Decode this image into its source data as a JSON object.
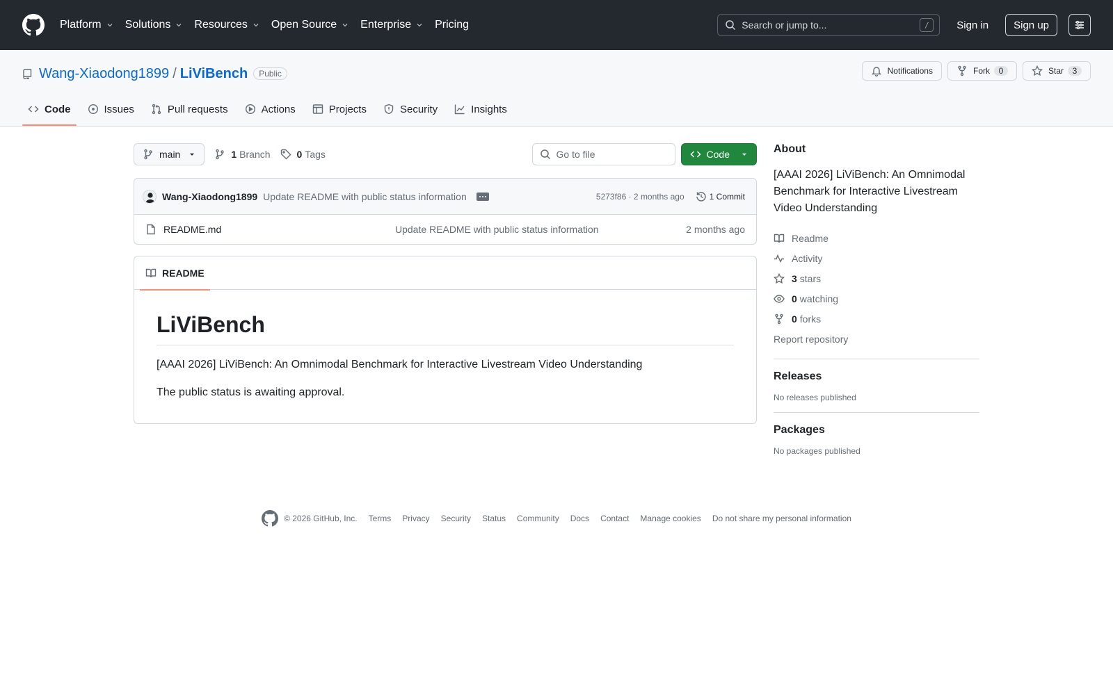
{
  "header": {
    "nav": [
      "Platform",
      "Solutions",
      "Resources",
      "Open Source",
      "Enterprise",
      "Pricing"
    ],
    "search_placeholder": "Search or jump to...",
    "search_key": "/",
    "sign_in": "Sign in",
    "sign_up": "Sign up"
  },
  "repo": {
    "owner": "Wang-Xiaodong1899",
    "separator": "/",
    "name": "LiViBench",
    "visibility": "Public",
    "notifications_label": "Notifications",
    "fork_label": "Fork",
    "fork_count": "0",
    "star_label": "Star",
    "star_count": "3"
  },
  "tabs": [
    "Code",
    "Issues",
    "Pull requests",
    "Actions",
    "Projects",
    "Security",
    "Insights"
  ],
  "file_nav": {
    "branch": "main",
    "branch_count": "1",
    "branch_label": "Branch",
    "tag_count": "0",
    "tag_label": "Tags",
    "goto_placeholder": "Go to file",
    "code_button": "Code"
  },
  "commit": {
    "author": "Wang-Xiaodong1899",
    "message": "Update README with public status information",
    "hash_time": "5273f86 · 2 months ago",
    "commit_count": "1 Commit"
  },
  "files": [
    {
      "name": "README.md",
      "message": "Update README with public status information",
      "age": "2 months ago"
    }
  ],
  "readme": {
    "tab_label": "README",
    "title": "LiViBench",
    "paragraphs": [
      "[AAAI 2026] LiViBench: An Omnimodal Benchmark for Interactive Livestream Video Understanding",
      "The public status is awaiting approval."
    ]
  },
  "about": {
    "title": "About",
    "description": "[AAAI 2026] LiViBench: An Omnimodal Benchmark for Interactive Livestream Video Understanding",
    "readme": "Readme",
    "activity": "Activity",
    "stars_count": "3",
    "stars_label": "stars",
    "watching_count": "0",
    "watching_label": "watching",
    "forks_count": "0",
    "forks_label": "forks",
    "report": "Report repository"
  },
  "releases": {
    "title": "Releases",
    "empty": "No releases published"
  },
  "packages": {
    "title": "Packages",
    "empty": "No packages published"
  },
  "footer": {
    "copyright": "© 2026 GitHub, Inc.",
    "links": [
      "Terms",
      "Privacy",
      "Security",
      "Status",
      "Community",
      "Docs",
      "Contact",
      "Manage cookies",
      "Do not share my personal information"
    ]
  },
  "colors": {
    "header_bg": "#24292f",
    "link": "#0969da",
    "code_button": "#1f883d",
    "tab_underline": "#fd8c73"
  }
}
